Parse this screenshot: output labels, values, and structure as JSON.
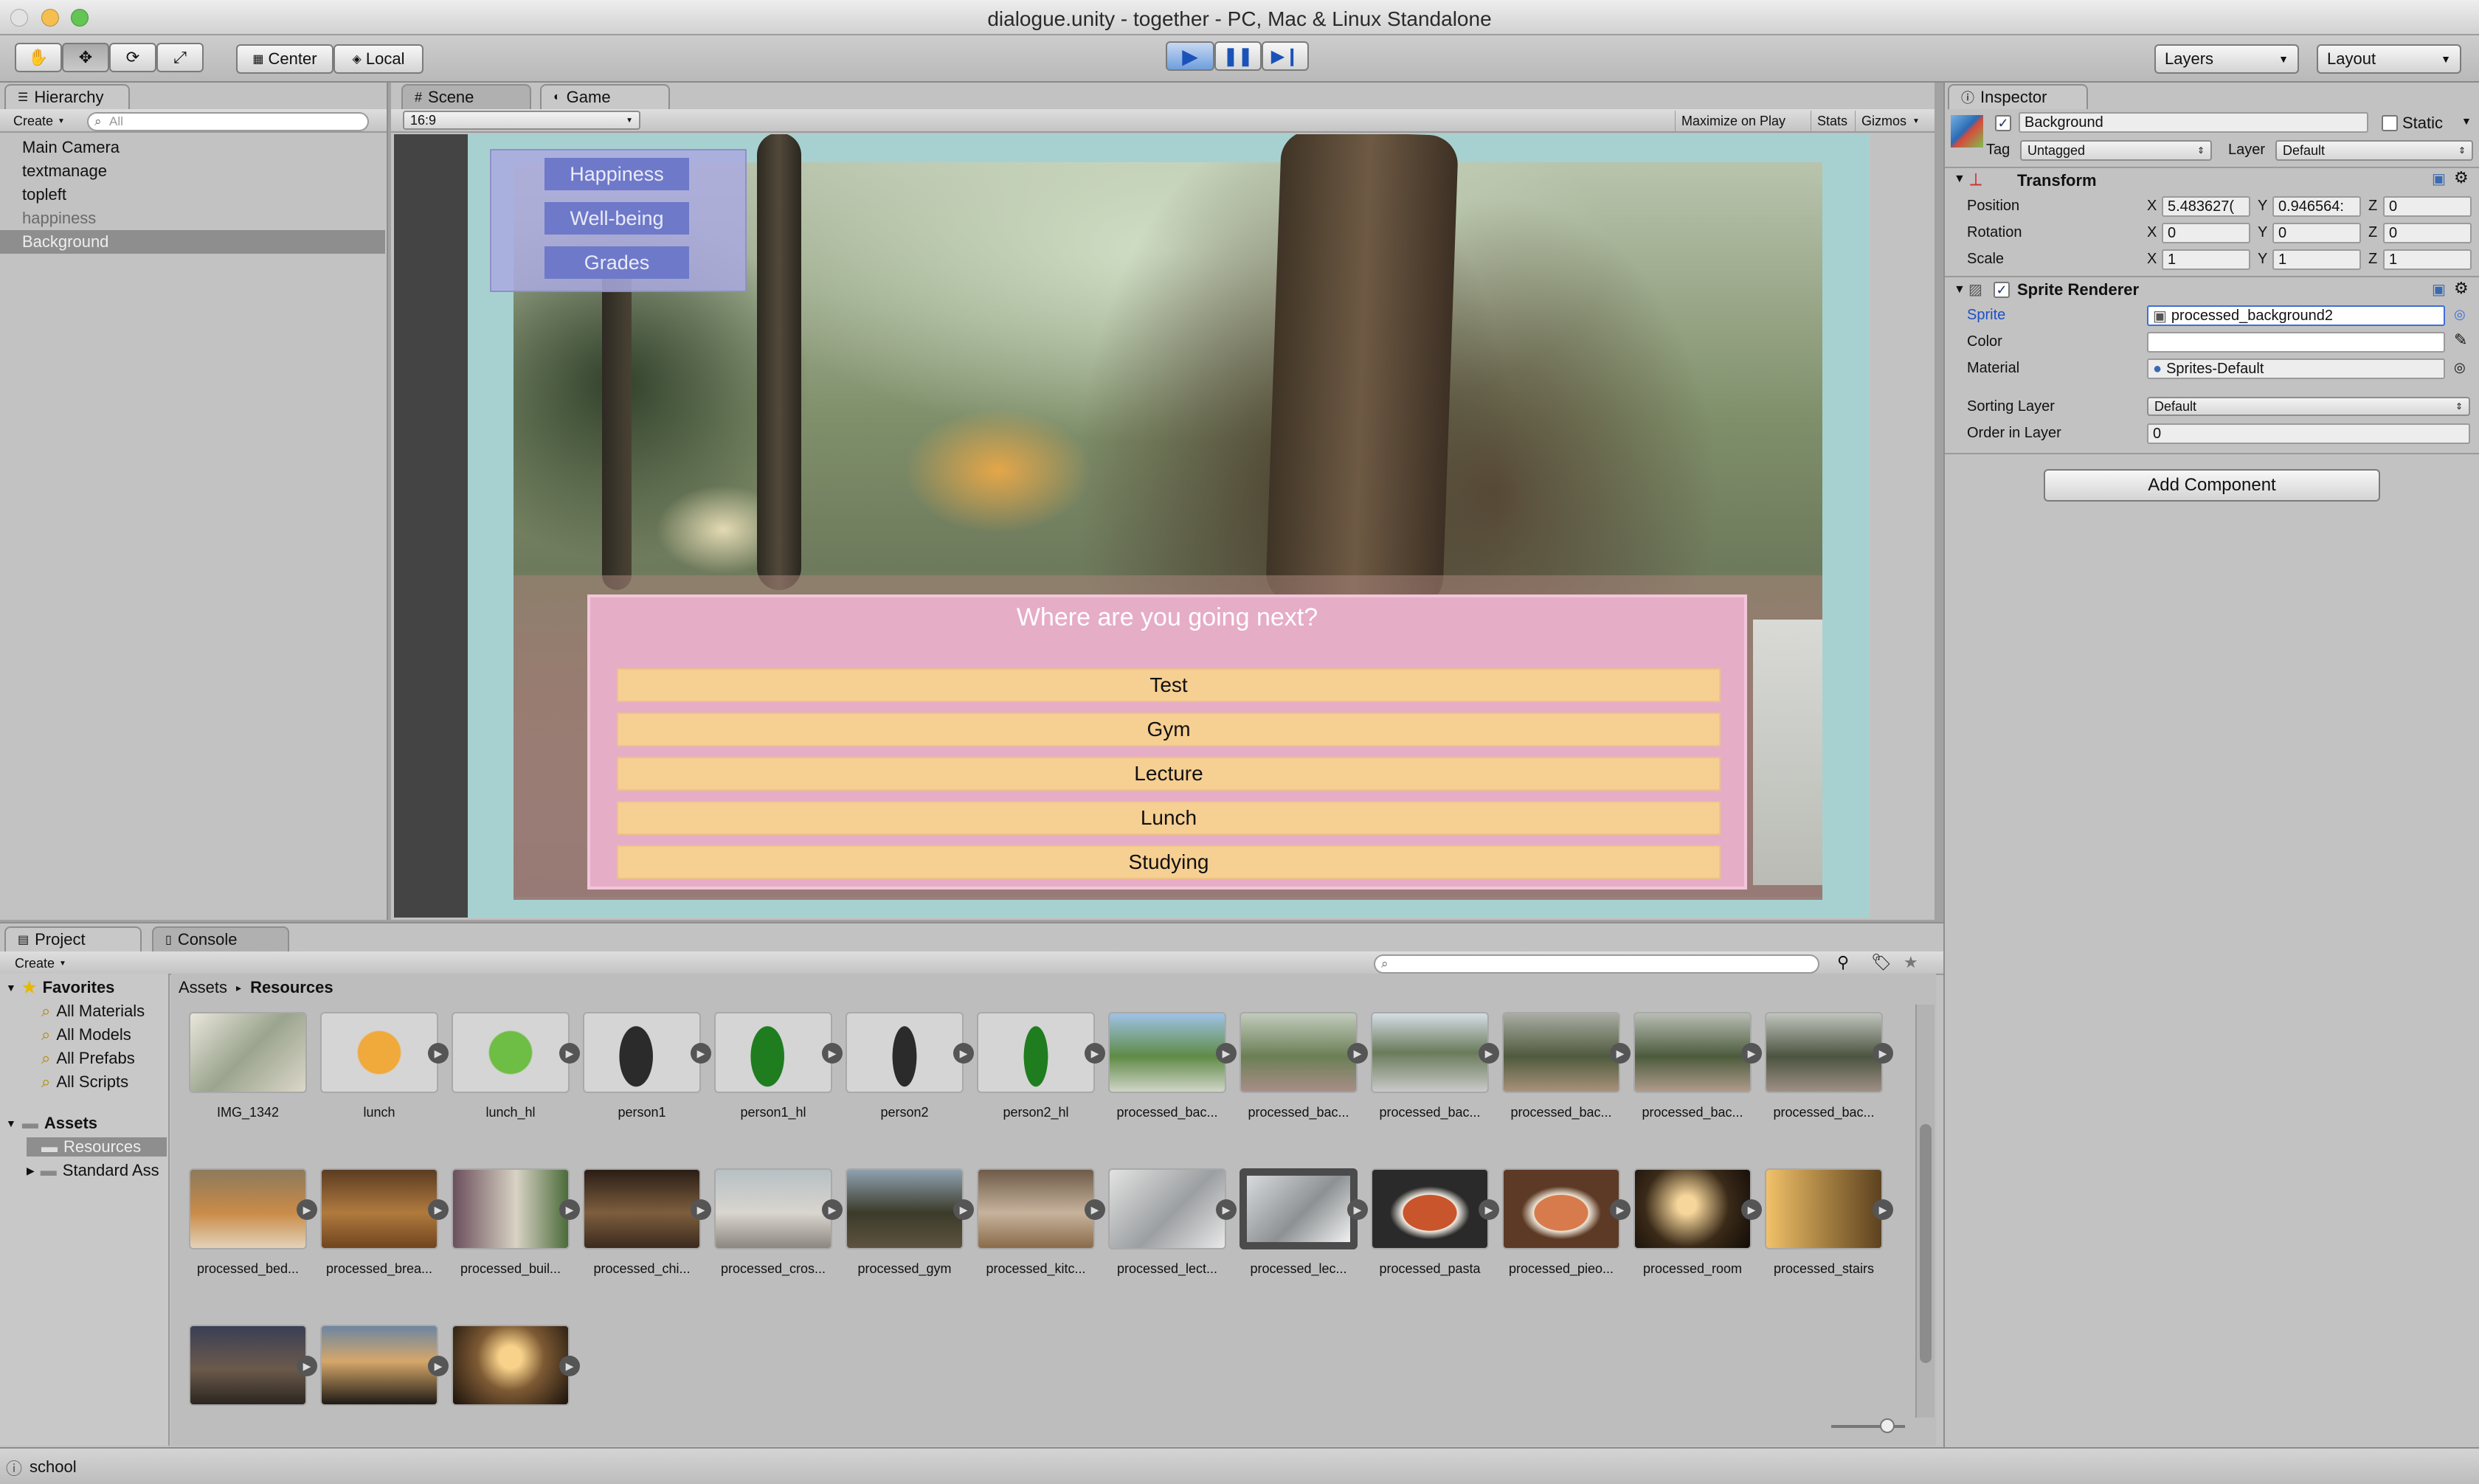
{
  "window": {
    "title": "dialogue.unity - together - PC, Mac & Linux Standalone"
  },
  "toolbar": {
    "tools": [
      "hand-icon",
      "move-icon",
      "rotate-icon",
      "scale-icon"
    ],
    "pivot_label": "Center",
    "space_label": "Local",
    "layers_label": "Layers",
    "layout_label": "Layout"
  },
  "hierarchy": {
    "tab_label": "Hierarchy",
    "create_label": "Create",
    "search_placeholder": "All",
    "items": [
      {
        "label": "Main Camera"
      },
      {
        "label": "textmanage"
      },
      {
        "label": "topleft"
      },
      {
        "label": "happiness"
      },
      {
        "label": "Background"
      }
    ]
  },
  "game": {
    "tabs": [
      {
        "label": "Scene"
      },
      {
        "label": "Game"
      }
    ],
    "aspect_label": "16:9",
    "maximize_label": "Maximize on Play",
    "stats_label": "Stats",
    "gizmos_label": "Gizmos",
    "stat_buttons": [
      "Happiness",
      "Well-being",
      "Grades"
    ],
    "question": "Where are you going next?",
    "choices": [
      "Test",
      "Gym",
      "Lecture",
      "Lunch",
      "Studying"
    ]
  },
  "inspector": {
    "tab_label": "Inspector",
    "object_name": "Background",
    "static_label": "Static",
    "tag_label": "Tag",
    "tag_value": "Untagged",
    "layer_label": "Layer",
    "layer_value": "Default",
    "transform": {
      "title": "Transform",
      "position_label": "Position",
      "rotation_label": "Rotation",
      "scale_label": "Scale",
      "position": {
        "x": "5.483627(",
        "y": "0.946564:",
        "z": "0"
      },
      "rotation": {
        "x": "0",
        "y": "0",
        "z": "0"
      },
      "scale": {
        "x": "1",
        "y": "1",
        "z": "1"
      }
    },
    "sprite_renderer": {
      "title": "Sprite Renderer",
      "sprite_label": "Sprite",
      "sprite_value": "processed_background2",
      "color_label": "Color",
      "material_label": "Material",
      "material_value": "Sprites-Default",
      "sorting_layer_label": "Sorting Layer",
      "sorting_layer_value": "Default",
      "order_label": "Order in Layer",
      "order_value": "0"
    },
    "add_component_label": "Add Component"
  },
  "project": {
    "tabs": [
      {
        "label": "Project"
      },
      {
        "label": "Console"
      }
    ],
    "create_label": "Create",
    "breadcrumb": [
      "Assets",
      "Resources"
    ],
    "favorites_label": "Favorites",
    "favorites": [
      "All Materials",
      "All Models",
      "All Prefabs",
      "All Scripts"
    ],
    "assets_label": "Assets",
    "asset_folders": [
      "Resources",
      "Standard Ass"
    ],
    "assets": [
      {
        "label": "IMG_1342"
      },
      {
        "label": "lunch"
      },
      {
        "label": "lunch_hl"
      },
      {
        "label": "person1"
      },
      {
        "label": "person1_hl"
      },
      {
        "label": "person2"
      },
      {
        "label": "person2_hl"
      },
      {
        "label": "processed_bac..."
      },
      {
        "label": "processed_bac..."
      },
      {
        "label": "processed_bac..."
      },
      {
        "label": "processed_bac..."
      },
      {
        "label": "processed_bac..."
      },
      {
        "label": "processed_bac..."
      },
      {
        "label": "processed_bed..."
      },
      {
        "label": "processed_brea..."
      },
      {
        "label": "processed_buil..."
      },
      {
        "label": "processed_chi..."
      },
      {
        "label": "processed_cros..."
      },
      {
        "label": "processed_gym"
      },
      {
        "label": "processed_kitc..."
      },
      {
        "label": "processed_lect..."
      },
      {
        "label": "processed_lec..."
      },
      {
        "label": "processed_pasta"
      },
      {
        "label": "processed_pieo..."
      },
      {
        "label": "processed_room"
      },
      {
        "label": "processed_stairs"
      },
      {
        "label": ""
      },
      {
        "label": ""
      },
      {
        "label": ""
      }
    ]
  },
  "status": {
    "message": "school"
  }
}
